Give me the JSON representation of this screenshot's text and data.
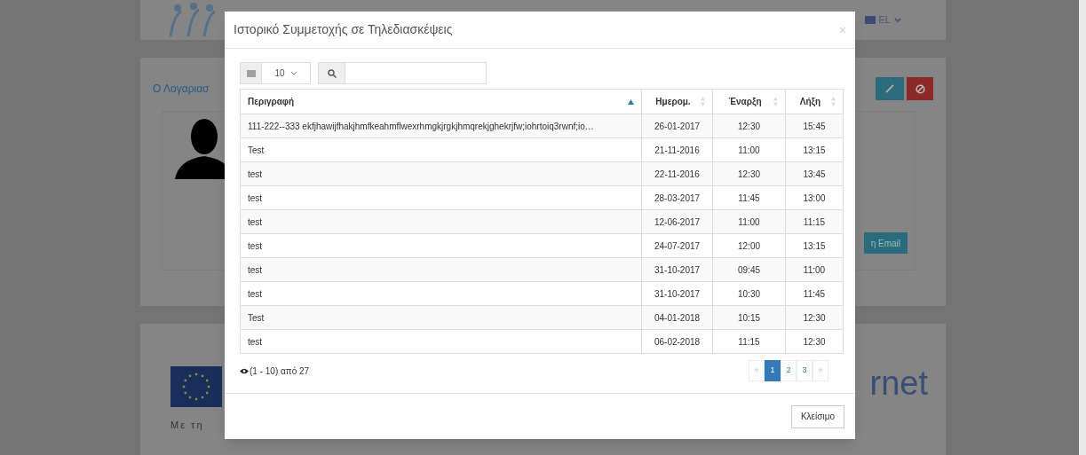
{
  "page": {
    "language": "EL",
    "account_title": "Ο Λογαριασ",
    "email_button": "η Email",
    "funding_text": "Με τη",
    "partner_logo_text": "rnet"
  },
  "modal": {
    "title": "Ιστορικό Συμμετοχής σε Τηλεδιασκέψεις",
    "close": "×",
    "page_size": "10",
    "table": {
      "columns": [
        {
          "label": "Περιγραφή",
          "sorted": true
        },
        {
          "label": "Ημερομ.",
          "sorted": false
        },
        {
          "label": "Έναρξη",
          "sorted": false
        },
        {
          "label": "Λήξη",
          "sorted": false
        }
      ],
      "rows": [
        [
          "111-222--333 ekfjhawijfhakjhmfkeahmflwexrhmgkjrgkjhmqrekjghekrjfw;iohrtoiq3rwnf;io…",
          "26-01-2017",
          "12:30",
          "15:45"
        ],
        [
          "Test",
          "21-11-2016",
          "11:00",
          "13:15"
        ],
        [
          "test",
          "22-11-2016",
          "12:30",
          "13:45"
        ],
        [
          "test",
          "28-03-2017",
          "11:45",
          "13:00"
        ],
        [
          "test",
          "12-06-2017",
          "11:00",
          "11:15"
        ],
        [
          "test",
          "24-07-2017",
          "12:00",
          "13:15"
        ],
        [
          "test",
          "31-10-2017",
          "09:45",
          "11:00"
        ],
        [
          "test",
          "31-10-2017",
          "10:30",
          "11:45"
        ],
        [
          "Test",
          "04-01-2018",
          "10:15",
          "12:30"
        ],
        [
          "test",
          "06-02-2018",
          "11:15",
          "12:30"
        ]
      ]
    },
    "info": "(1 - 10) από 27",
    "pagination": [
      {
        "label": "«",
        "kind": "prev",
        "selected": false
      },
      {
        "label": "1",
        "kind": "page",
        "selected": true
      },
      {
        "label": "2",
        "kind": "page",
        "selected": false
      },
      {
        "label": "3",
        "kind": "page",
        "selected": false
      },
      {
        "label": "»",
        "kind": "next",
        "selected": false
      }
    ],
    "footer_button": "Κλείσιμο"
  }
}
